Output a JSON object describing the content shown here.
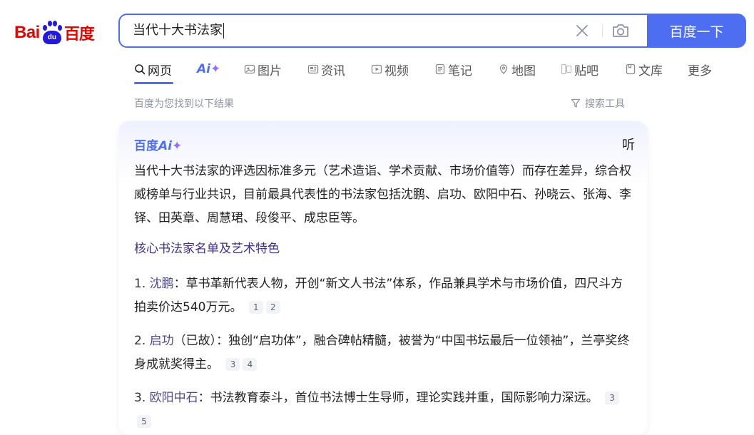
{
  "logo": {
    "part1": "Bai",
    "paw_text": "du",
    "part2": "百度"
  },
  "search": {
    "query": "当代十大书法家",
    "button_label": "百度一下"
  },
  "tabs": [
    {
      "label": "网页"
    },
    {
      "label": "Ai"
    },
    {
      "label": "图片"
    },
    {
      "label": "资讯"
    },
    {
      "label": "视频"
    },
    {
      "label": "笔记"
    },
    {
      "label": "地图"
    },
    {
      "label": "贴吧"
    },
    {
      "label": "文库"
    },
    {
      "label": "更多"
    }
  ],
  "results_meta": {
    "count_text": "百度为您找到以下结果",
    "tools_label": "搜索工具"
  },
  "ai_card": {
    "brand_prefix": "百度",
    "brand_ai": "Ai",
    "listen_label": "听",
    "summary": "当代十大书法家的评选因标准多元（艺术造诣、学术贡献、市场价值等）而存在差异，综合权威榜单与行业共识，目前最具代表性的书法家包括沈鹏、启功、欧阳中石、孙晓云、张海、李铎、田英章、周慧珺、段俊平、成忠臣等。",
    "section_title": "核心书法家名单及艺术特色",
    "items": [
      {
        "num": "1.",
        "name": "沈鹏",
        "text": "：草书革新代表人物，开创“新文人书法”体系，作品兼具学术与市场价值，四尺斗方拍卖价达540万元。",
        "cite1": "1",
        "cite2": "2"
      },
      {
        "num": "2.",
        "name": "启功",
        "text": "（已故）：独创“启功体”，融合碑帖精髓，被誉为“中国书坛最后一位领袖”，兰亭奖终身成就奖得主。",
        "cite1": "3",
        "cite2": "4"
      },
      {
        "num": "3.",
        "name": "欧阳中石",
        "text": "：书法教育泰斗，首位书法博士生导师，理论实践并重，国际影响力深远。",
        "cite1": "3",
        "cite2": "5"
      }
    ]
  },
  "colors": {
    "brand_blue": "#4e6ef2",
    "logo_red": "#e10602",
    "logo_blue": "#2319dc",
    "ai_purple": "#9a6bff"
  }
}
